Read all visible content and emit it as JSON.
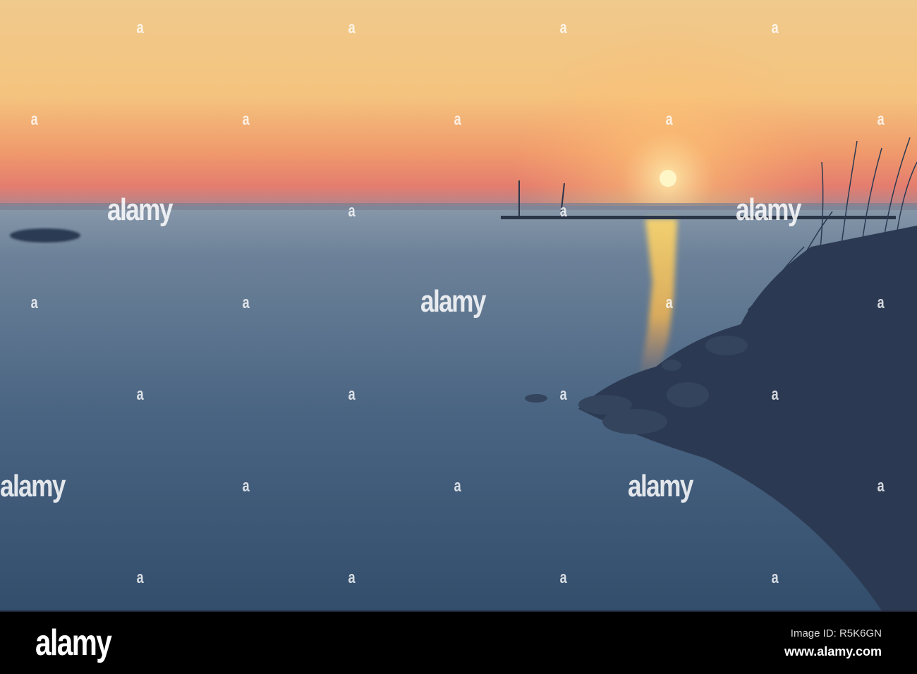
{
  "watermark": {
    "text": "alamy",
    "glyph": "a"
  },
  "footer": {
    "logo": "alamy",
    "image_id": "Image ID: R5K6GN",
    "url": "www.alamy.com"
  },
  "colors": {
    "sky_top": "#f2cf8c",
    "horizon": "#e9806a",
    "water": "#3f5878",
    "sun": "#fff6c8"
  }
}
